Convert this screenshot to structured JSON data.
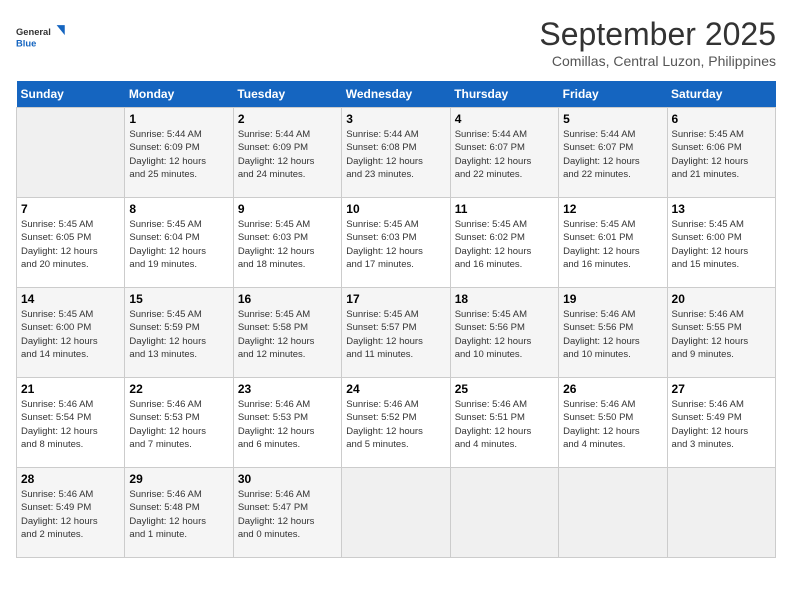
{
  "header": {
    "logo_line1": "General",
    "logo_line2": "Blue",
    "month": "September 2025",
    "location": "Comillas, Central Luzon, Philippines"
  },
  "weekdays": [
    "Sunday",
    "Monday",
    "Tuesday",
    "Wednesday",
    "Thursday",
    "Friday",
    "Saturday"
  ],
  "weeks": [
    [
      {
        "day": "",
        "info": ""
      },
      {
        "day": "1",
        "info": "Sunrise: 5:44 AM\nSunset: 6:09 PM\nDaylight: 12 hours\nand 25 minutes."
      },
      {
        "day": "2",
        "info": "Sunrise: 5:44 AM\nSunset: 6:09 PM\nDaylight: 12 hours\nand 24 minutes."
      },
      {
        "day": "3",
        "info": "Sunrise: 5:44 AM\nSunset: 6:08 PM\nDaylight: 12 hours\nand 23 minutes."
      },
      {
        "day": "4",
        "info": "Sunrise: 5:44 AM\nSunset: 6:07 PM\nDaylight: 12 hours\nand 22 minutes."
      },
      {
        "day": "5",
        "info": "Sunrise: 5:44 AM\nSunset: 6:07 PM\nDaylight: 12 hours\nand 22 minutes."
      },
      {
        "day": "6",
        "info": "Sunrise: 5:45 AM\nSunset: 6:06 PM\nDaylight: 12 hours\nand 21 minutes."
      }
    ],
    [
      {
        "day": "7",
        "info": "Sunrise: 5:45 AM\nSunset: 6:05 PM\nDaylight: 12 hours\nand 20 minutes."
      },
      {
        "day": "8",
        "info": "Sunrise: 5:45 AM\nSunset: 6:04 PM\nDaylight: 12 hours\nand 19 minutes."
      },
      {
        "day": "9",
        "info": "Sunrise: 5:45 AM\nSunset: 6:03 PM\nDaylight: 12 hours\nand 18 minutes."
      },
      {
        "day": "10",
        "info": "Sunrise: 5:45 AM\nSunset: 6:03 PM\nDaylight: 12 hours\nand 17 minutes."
      },
      {
        "day": "11",
        "info": "Sunrise: 5:45 AM\nSunset: 6:02 PM\nDaylight: 12 hours\nand 16 minutes."
      },
      {
        "day": "12",
        "info": "Sunrise: 5:45 AM\nSunset: 6:01 PM\nDaylight: 12 hours\nand 16 minutes."
      },
      {
        "day": "13",
        "info": "Sunrise: 5:45 AM\nSunset: 6:00 PM\nDaylight: 12 hours\nand 15 minutes."
      }
    ],
    [
      {
        "day": "14",
        "info": "Sunrise: 5:45 AM\nSunset: 6:00 PM\nDaylight: 12 hours\nand 14 minutes."
      },
      {
        "day": "15",
        "info": "Sunrise: 5:45 AM\nSunset: 5:59 PM\nDaylight: 12 hours\nand 13 minutes."
      },
      {
        "day": "16",
        "info": "Sunrise: 5:45 AM\nSunset: 5:58 PM\nDaylight: 12 hours\nand 12 minutes."
      },
      {
        "day": "17",
        "info": "Sunrise: 5:45 AM\nSunset: 5:57 PM\nDaylight: 12 hours\nand 11 minutes."
      },
      {
        "day": "18",
        "info": "Sunrise: 5:45 AM\nSunset: 5:56 PM\nDaylight: 12 hours\nand 10 minutes."
      },
      {
        "day": "19",
        "info": "Sunrise: 5:46 AM\nSunset: 5:56 PM\nDaylight: 12 hours\nand 10 minutes."
      },
      {
        "day": "20",
        "info": "Sunrise: 5:46 AM\nSunset: 5:55 PM\nDaylight: 12 hours\nand 9 minutes."
      }
    ],
    [
      {
        "day": "21",
        "info": "Sunrise: 5:46 AM\nSunset: 5:54 PM\nDaylight: 12 hours\nand 8 minutes."
      },
      {
        "day": "22",
        "info": "Sunrise: 5:46 AM\nSunset: 5:53 PM\nDaylight: 12 hours\nand 7 minutes."
      },
      {
        "day": "23",
        "info": "Sunrise: 5:46 AM\nSunset: 5:53 PM\nDaylight: 12 hours\nand 6 minutes."
      },
      {
        "day": "24",
        "info": "Sunrise: 5:46 AM\nSunset: 5:52 PM\nDaylight: 12 hours\nand 5 minutes."
      },
      {
        "day": "25",
        "info": "Sunrise: 5:46 AM\nSunset: 5:51 PM\nDaylight: 12 hours\nand 4 minutes."
      },
      {
        "day": "26",
        "info": "Sunrise: 5:46 AM\nSunset: 5:50 PM\nDaylight: 12 hours\nand 4 minutes."
      },
      {
        "day": "27",
        "info": "Sunrise: 5:46 AM\nSunset: 5:49 PM\nDaylight: 12 hours\nand 3 minutes."
      }
    ],
    [
      {
        "day": "28",
        "info": "Sunrise: 5:46 AM\nSunset: 5:49 PM\nDaylight: 12 hours\nand 2 minutes."
      },
      {
        "day": "29",
        "info": "Sunrise: 5:46 AM\nSunset: 5:48 PM\nDaylight: 12 hours\nand 1 minute."
      },
      {
        "day": "30",
        "info": "Sunrise: 5:46 AM\nSunset: 5:47 PM\nDaylight: 12 hours\nand 0 minutes."
      },
      {
        "day": "",
        "info": ""
      },
      {
        "day": "",
        "info": ""
      },
      {
        "day": "",
        "info": ""
      },
      {
        "day": "",
        "info": ""
      }
    ]
  ]
}
